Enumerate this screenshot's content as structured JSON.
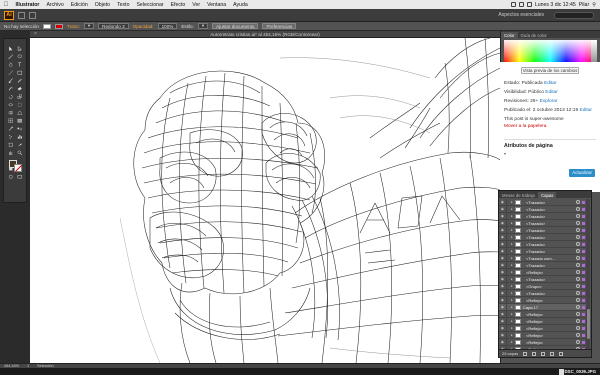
{
  "menubar": {
    "app": "Illustrator",
    "items": [
      "Archivo",
      "Edición",
      "Objeto",
      "Texto",
      "Seleccionar",
      "Efecto",
      "Ver",
      "Ventana",
      "Ayuda"
    ],
    "clock": "Lunes 3 dic 12:45",
    "user": "Pilar"
  },
  "appbar": {
    "logo": "Ai",
    "workspace": "Aspectos esenciales"
  },
  "controlbar": {
    "no_selection": "No hay selección",
    "stroke_label": "Trazo:",
    "brush": "Redondo 3",
    "opacity_label": "Opacidad:",
    "opacity": "100%",
    "style_label": "Estilo:",
    "doc_setup": "Ajustar documento",
    "preferences": "Preferencias"
  },
  "doc": {
    "title": "Autorretrato cristian.ai* al 454,16% (RGB/Contornear)",
    "zoom": "454,16%"
  },
  "color_panel": {
    "tabs": [
      "Color",
      "Guía de color"
    ]
  },
  "web_panel": {
    "preview_button": "Vista previa de los cambios",
    "rows": [
      {
        "label": "Estado: Publicada",
        "link": "Editar"
      },
      {
        "label": "Visibilidad: Público",
        "link": "Editar"
      },
      {
        "label": "Revisiones: 29+",
        "link": "Explorar"
      },
      {
        "label": "Publicado el: 2 octubre 2013 12:19",
        "link": "Editar"
      },
      {
        "label": "This post is super-awesome",
        "link": ""
      }
    ],
    "trash": "Mover a la papelera",
    "update": "Actualizar",
    "section": "Atributos de página"
  },
  "layers_panel": {
    "tabs": [
      "Mesas de trabajo",
      "Capas"
    ],
    "rows": [
      "<Trazado>",
      "<Trazado>",
      "<Trazado>",
      "<Trazado>",
      "<Trazado>",
      "<Trazado>",
      "<Trazado>",
      "<Trazado>",
      "<Trazado com...",
      "<Trazado>",
      "<Reflejo>",
      "<Trazado>",
      "<Grupo>",
      "<Trazado>",
      "<Reflejo>",
      "Capa 17",
      "<Reflejo>",
      "<Reflejo>",
      "<Reflejo>",
      "<Reflejo>",
      "<Reflejo>",
      "<Reflejo>",
      "<Reflejo>",
      "<Reflejo>",
      "Remarco",
      "PLANTILLA"
    ],
    "footer": "29 capas"
  },
  "statusbar": {
    "zoom": "454,16%",
    "page": "1",
    "tool": "Selección"
  },
  "dock": {
    "filename": "DSC_0039.JPG"
  }
}
